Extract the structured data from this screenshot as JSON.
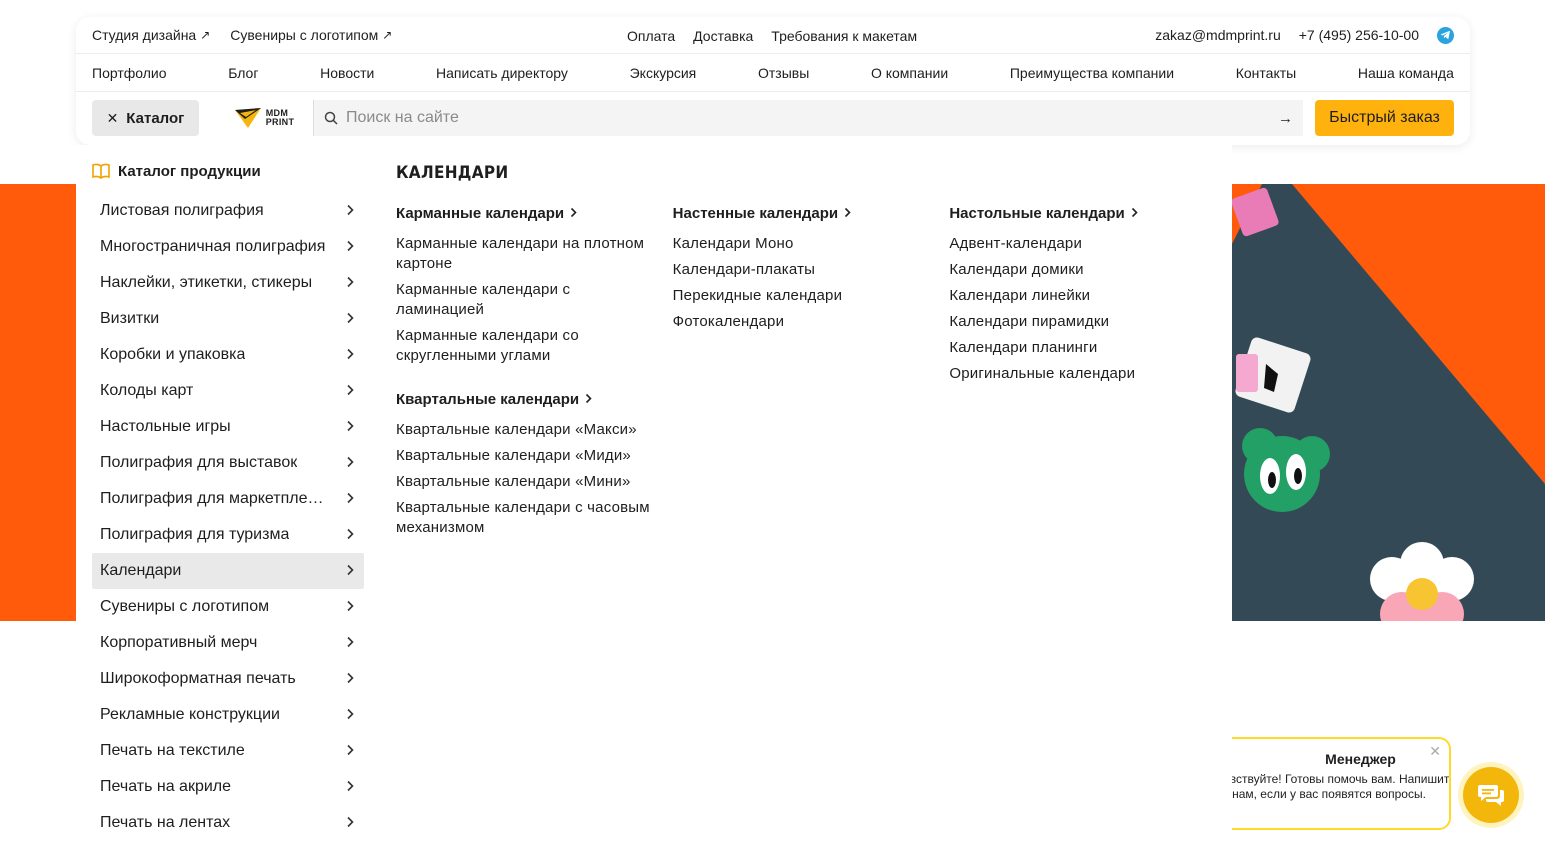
{
  "colors": {
    "accent_orange": "#ff5b0a",
    "button_yellow": "#ffb20e",
    "chat_yellow": "#f2b70a",
    "telegram_blue": "#2aa3df",
    "active_item_bg": "#e9e9e9"
  },
  "topbar": {
    "left_links": [
      {
        "label": "Студия дизайна",
        "icon": "arrow-up-right-icon"
      },
      {
        "label": "Сувениры с логотипом",
        "icon": "arrow-up-right-icon"
      }
    ],
    "center_links": [
      "Оплата",
      "Доставка",
      "Требования к макетам"
    ],
    "email": "zakaz@mdmprint.ru",
    "phone": "+7 (495) 256-10-00",
    "messenger_icon": "telegram-icon"
  },
  "nav": {
    "items": [
      "Портфолио",
      "Блог",
      "Новости",
      "Написать директору",
      "Экскурсия",
      "Отзывы",
      "О компании",
      "Преимущества компании",
      "Контакты",
      "Наша команда"
    ]
  },
  "search": {
    "catalog_label": "Каталог",
    "catalog_icon": "close-icon",
    "logo_line1": "MDM",
    "logo_line2": "PRINT",
    "placeholder": "Поиск на сайте",
    "search_icon": "search-icon",
    "submit_icon": "arrow-right-icon",
    "quick_order_label": "Быстрый заказ"
  },
  "catalog": {
    "title": "Каталог продукции",
    "title_icon": "book-icon",
    "active_index": 11,
    "items": [
      "Листовая полиграфия",
      "Многостраничная полиграфия",
      "Наклейки, этикетки, стикеры",
      "Визитки",
      "Коробки и упаковка",
      "Колоды карт",
      "Настольные игры",
      "Полиграфия для выставок",
      "Полиграфия для маркетплейсов",
      "Полиграфия для туризма",
      "Календари",
      "Сувениры с логотипом",
      "Корпоративный мерч",
      "Широкоформатная печать",
      "Рекламные конструкции",
      "Печать на текстиле",
      "Печать на акриле",
      "Печать на лентах"
    ]
  },
  "submenu": {
    "title": "КАЛЕНДАРИ",
    "columns": [
      [
        {
          "title": "Карманные календари",
          "links": [
            "Карманные календари на плотном картоне",
            "Карманные календари с ламинацией",
            "Карманные календари со скругленными углами"
          ]
        },
        {
          "title": "Квартальные календари",
          "links": [
            "Квартальные календари «Макси»",
            "Квартальные календари «Миди»",
            "Квартальные календари «Мини»",
            "Квартальные календари с часовым механизмом"
          ]
        }
      ],
      [
        {
          "title": "Настенные календари",
          "links": [
            "Календари Моно",
            "Календари-плакаты",
            "Перекидные календари",
            "Фотокалендари"
          ]
        }
      ],
      [
        {
          "title": "Настольные календари",
          "links": [
            "Адвент-календари",
            "Календари домики",
            "Календари линейки",
            "Календари пирамидки",
            "Календари планинги",
            "Оригинальные календари"
          ]
        }
      ]
    ]
  },
  "chat": {
    "name": "Менеджер",
    "message": "Здравствуйте! Готовы помочь вам. Напишите нам, если у вас появятся вопросы.",
    "close_icon": "close-icon",
    "button_icon": "chat-icon"
  }
}
